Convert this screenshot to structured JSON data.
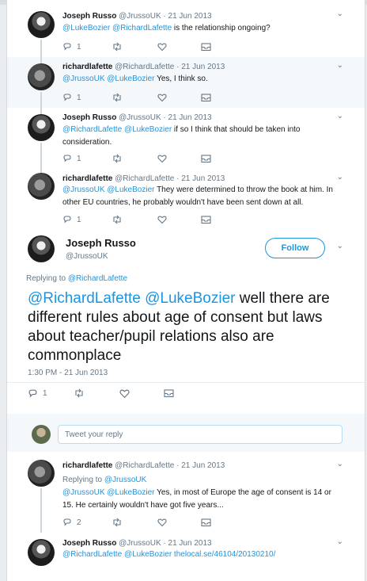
{
  "tweets": [
    {
      "name": "Joseph Russo",
      "handle": "@JrussoUK",
      "date": "· 21 Jun 2013",
      "mentions": "@LukeBozier @RichardLafette",
      "text": " is the relationship ongoing?",
      "replies": "1"
    },
    {
      "name": "richardlafette",
      "handle": "@RichardLafette",
      "date": "· 21 Jun 2013",
      "mentions": "@JrussoUK @LukeBozier",
      "text": " Yes, I think so.",
      "replies": "1"
    },
    {
      "name": "Joseph Russo",
      "handle": "@JrussoUK",
      "date": "· 21 Jun 2013",
      "mentions": "@RichardLafette @LukeBozier",
      "text": " if so I think that should be taken into consideration.",
      "replies": "1"
    },
    {
      "name": "richardlafette",
      "handle": "@RichardLafette",
      "date": "· 21 Jun 2013",
      "mentions": "@JrussoUK @LukeBozier",
      "text": " They were determined to throw the book at him. In other EU countries, he probably wouldn't have been sent down at all.",
      "replies": "1"
    }
  ],
  "main_tweet": {
    "name": "Joseph Russo",
    "handle": "@JrussoUK",
    "follow_label": "Follow",
    "replying_prefix": "Replying to ",
    "replying_to": "@RichardLafette",
    "mentions": "@RichardLafette @LukeBozier",
    "text": " well there are different rules about age of consent but laws about teacher/pupil relations also are commonplace",
    "time": "1:30 PM - 21 Jun 2013",
    "replies": "1"
  },
  "reply_box": {
    "placeholder": "Tweet your reply"
  },
  "replies": [
    {
      "name": "richardlafette",
      "handle": "@RichardLafette",
      "date": "· 21 Jun 2013",
      "replying_prefix": "Replying to ",
      "replying_to": "@JrussoUK",
      "mentions": "@JrussoUK @LukeBozier",
      "text": " Yes, in most of Europe the age of consent is 14 or 15. He certainly wouldn't have got five years...",
      "replies": "2"
    },
    {
      "name": "Joseph Russo",
      "handle": "@JrussoUK",
      "date": "· 21 Jun 2013",
      "mentions": "@RichardLafette @LukeBozier",
      "link": " thelocal.se/46104/20130210/"
    }
  ],
  "colors": {
    "accent": "#1b95e0",
    "muted": "#657786",
    "alt_background": "#f5f8fa"
  }
}
